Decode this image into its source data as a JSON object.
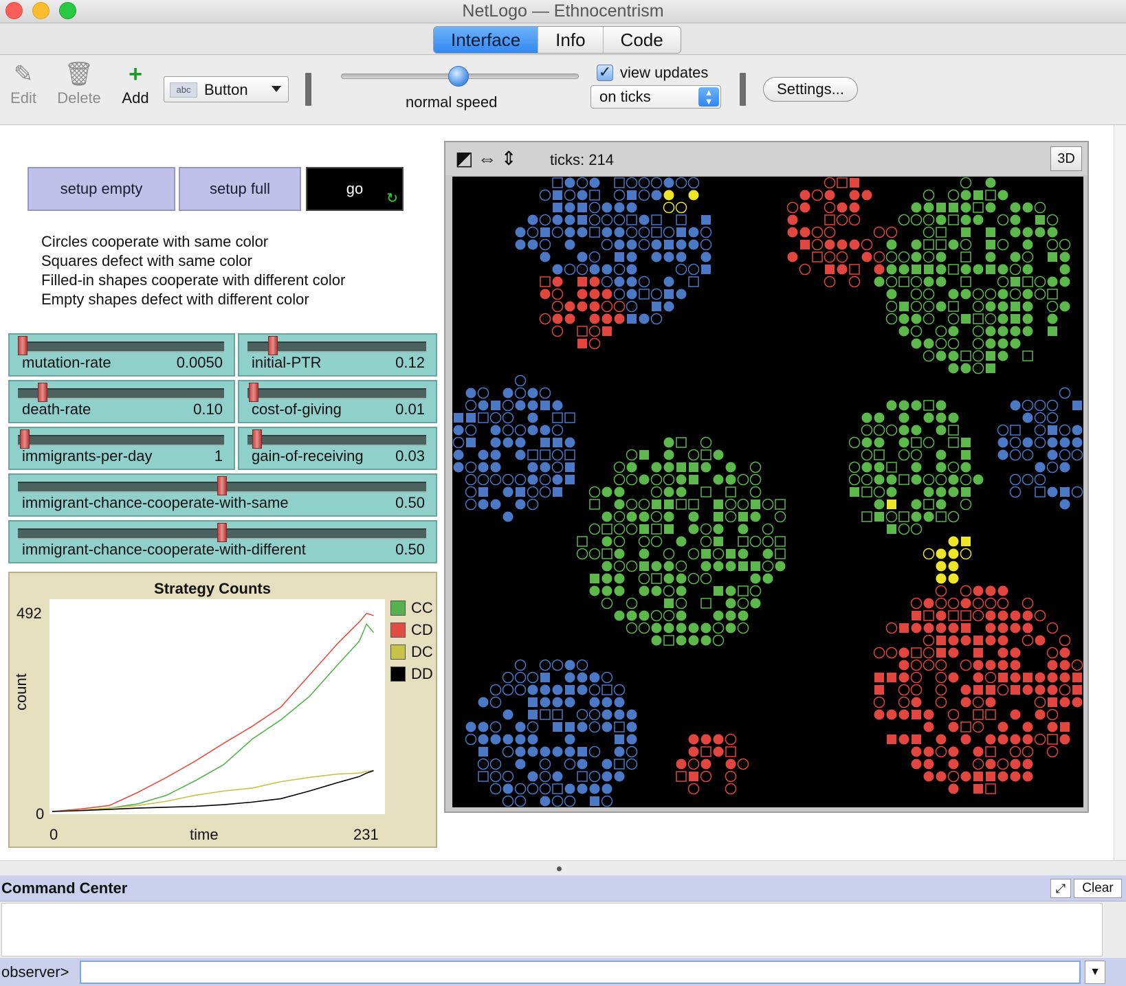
{
  "window": {
    "title": "NetLogo — Ethnocentrism"
  },
  "tabs": [
    {
      "label": "Interface"
    },
    {
      "label": "Info"
    },
    {
      "label": "Code"
    }
  ],
  "toolbar": {
    "edit_label": "Edit",
    "delete_label": "Delete",
    "add_label": "Add",
    "widget_type": "Button",
    "widget_icon_text": "abc",
    "speed_label": "normal speed",
    "speed_fraction": 0.5,
    "view_updates_label": "view updates",
    "view_updates_checked": true,
    "update_mode": "on ticks",
    "settings_label": "Settings..."
  },
  "buttons": {
    "setup_empty": "setup empty",
    "setup_full": "setup full",
    "go": "go",
    "go_forever_icon": "↻"
  },
  "note": [
    "Circles cooperate with same color",
    "Squares defect with same color",
    "Filled-in shapes cooperate with different color",
    "Empty shapes defect with different color"
  ],
  "sliders": [
    {
      "name": "mutation-rate",
      "value": "0.0050",
      "fraction": 0.0
    },
    {
      "name": "initial-PTR",
      "value": "0.12",
      "fraction": 0.12
    },
    {
      "name": "death-rate",
      "value": "0.10",
      "fraction": 0.1
    },
    {
      "name": "cost-of-giving",
      "value": "0.01",
      "fraction": 0.01
    },
    {
      "name": "immigrants-per-day",
      "value": "1",
      "fraction": 0.01
    },
    {
      "name": "gain-of-receiving",
      "value": "0.03",
      "fraction": 0.03
    },
    {
      "name": "immigrant-chance-cooperate-with-same",
      "value": "0.50",
      "fraction": 0.5
    },
    {
      "name": "immigrant-chance-cooperate-with-different",
      "value": "0.50",
      "fraction": 0.5
    }
  ],
  "plot": {
    "title": "Strategy Counts",
    "ymax_label": "492",
    "ymin_label": "0",
    "xmin_label": "0",
    "xmax_label": "231",
    "xlabel": "time",
    "ylabel": "count"
  },
  "chart_data": {
    "type": "line",
    "title": "Strategy Counts",
    "xlabel": "time",
    "ylabel": "count",
    "xlim": [
      0,
      231
    ],
    "ylim": [
      0,
      492
    ],
    "legend_position": "right",
    "x": [
      0,
      20,
      40,
      60,
      80,
      100,
      120,
      140,
      160,
      180,
      200,
      215,
      220,
      225
    ],
    "series": [
      {
        "name": "CC",
        "color": "#55b24f",
        "values": [
          0,
          3,
          8,
          18,
          38,
          72,
          110,
          170,
          215,
          270,
          345,
          400,
          440,
          420
        ]
      },
      {
        "name": "CD",
        "color": "#e24d43",
        "values": [
          0,
          6,
          14,
          45,
          80,
          118,
          160,
          200,
          245,
          320,
          395,
          445,
          465,
          460
        ]
      },
      {
        "name": "DC",
        "color": "#c8c247",
        "values": [
          0,
          3,
          8,
          14,
          24,
          38,
          48,
          55,
          70,
          80,
          88,
          90,
          94,
          96
        ]
      },
      {
        "name": "DD",
        "color": "#000000",
        "values": [
          0,
          2,
          5,
          8,
          10,
          12,
          16,
          22,
          30,
          48,
          68,
          82,
          90,
          96
        ]
      }
    ]
  },
  "view": {
    "ticks_text": "ticks: 214",
    "btn_3d": "3D",
    "world_cols": 51,
    "world_rows": 51,
    "seed": 214
  },
  "palette": {
    "blue": "#4b79c6",
    "red": "#e2463f",
    "green": "#5cb84a",
    "yellow": "#f0e628"
  },
  "command_center": {
    "title": "Command Center",
    "clear_label": "Clear",
    "prompt": "observer>"
  }
}
